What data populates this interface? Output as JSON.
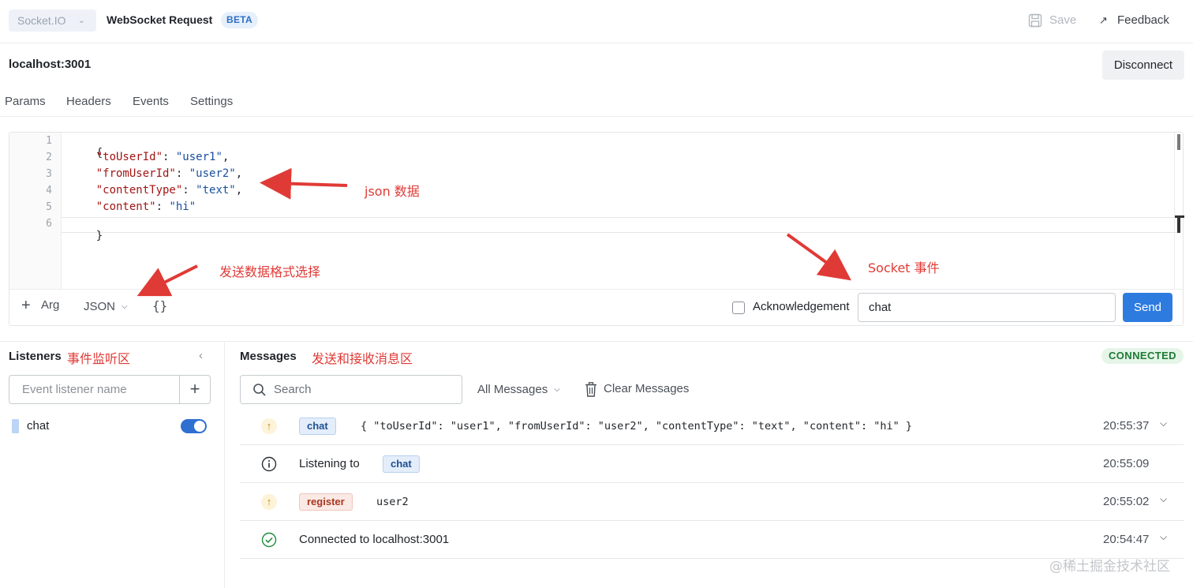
{
  "topbar": {
    "protocol": "Socket.IO",
    "title": "WebSocket Request",
    "badge": "BETA",
    "save_label": "Save",
    "feedback_label": "Feedback"
  },
  "url": "localhost:3001",
  "disconnect_label": "Disconnect",
  "tabs": [
    "Params",
    "Headers",
    "Events",
    "Settings"
  ],
  "editor": {
    "line_numbers": [
      "1",
      "2",
      "3",
      "4",
      "5",
      "6"
    ],
    "lines": [
      {
        "key": "",
        "value": "",
        "open": "{"
      },
      {
        "key": "\"toUserId\"",
        "value": "\"user1\"",
        "suffix": ","
      },
      {
        "key": "\"fromUserId\"",
        "value": "\"user2\"",
        "suffix": ","
      },
      {
        "key": "\"contentType\"",
        "value": "\"text\"",
        "suffix": ","
      },
      {
        "key": "\"content\"",
        "value": "\"hi\"",
        "suffix": ""
      },
      {
        "key": "",
        "value": "",
        "close": "}"
      }
    ]
  },
  "editor_footer": {
    "add_arg_label": "Arg",
    "format": "JSON",
    "format_icon": "{}",
    "ack_label": "Acknowledgement",
    "ack_checked": false,
    "event_value": "chat",
    "send_label": "Send"
  },
  "annotations": {
    "json_data": "json 数据",
    "format_select": "发送数据格式选择",
    "socket_event": "Socket 事件",
    "listeners_area": "事件监听区",
    "messages_area": "发送和接收消息区"
  },
  "listeners": {
    "title": "Listeners",
    "input_placeholder": "Event listener name",
    "items": [
      {
        "name": "chat",
        "enabled": true
      }
    ]
  },
  "messages": {
    "title": "Messages",
    "status": "CONNECTED",
    "search_placeholder": "Search",
    "filter": "All Messages",
    "clear_label": "Clear Messages",
    "rows": [
      {
        "icon": "arrow-up-icon",
        "tag": "chat",
        "tag_color": "blue",
        "text": "{ \"toUserId\": \"user1\", \"fromUserId\": \"user2\", \"contentType\": \"text\", \"content\": \"hi\" }",
        "time": "20:55:37",
        "expandable": true
      },
      {
        "icon": "info-icon",
        "prefix": "Listening to",
        "tag": "chat",
        "tag_color": "blue",
        "time": "20:55:09",
        "expandable": false
      },
      {
        "icon": "arrow-up-icon",
        "tag": "register",
        "tag_color": "red",
        "text": "user2",
        "time": "20:55:02",
        "expandable": true
      },
      {
        "icon": "check-circle-icon",
        "text": "Connected to localhost:3001",
        "time": "20:54:47",
        "expandable": true
      }
    ]
  },
  "watermark": "@稀土掘金技术社区",
  "colors": {
    "accent": "#2e7be0",
    "annotation": "#e03a36",
    "connected": "#1e7a34"
  }
}
